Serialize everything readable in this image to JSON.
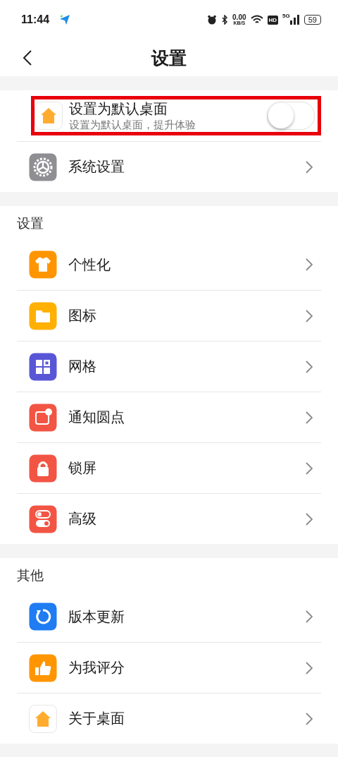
{
  "status_bar": {
    "time": "11:44",
    "speed": "0.00",
    "speed_unit": "KB/S",
    "hd": "HD",
    "network": "5G",
    "battery": "59"
  },
  "header": {
    "title": "设置"
  },
  "sections": [
    {
      "items": [
        {
          "kind": "toggle",
          "label": "设置为默认桌面",
          "subtitle": "设置为默认桌面，提升体验",
          "on": false,
          "highlighted": true
        },
        {
          "kind": "link",
          "label": "系统设置",
          "highlighted": false
        }
      ]
    },
    {
      "title": "设置",
      "items": [
        {
          "kind": "link",
          "label": "个性化",
          "highlighted": false
        },
        {
          "kind": "link",
          "label": "图标",
          "highlighted": false
        },
        {
          "kind": "link",
          "label": "网格",
          "highlighted": false
        },
        {
          "kind": "link",
          "label": "通知圆点",
          "highlighted": false
        },
        {
          "kind": "link",
          "label": "锁屏",
          "highlighted": false
        },
        {
          "kind": "link",
          "label": "高级",
          "highlighted": false
        }
      ]
    },
    {
      "title": "其他",
      "items": [
        {
          "kind": "link",
          "label": "版本更新",
          "highlighted": false
        },
        {
          "kind": "link",
          "label": "为我评分",
          "highlighted": false
        },
        {
          "kind": "link",
          "label": "关于桌面",
          "highlighted": false
        }
      ]
    }
  ]
}
